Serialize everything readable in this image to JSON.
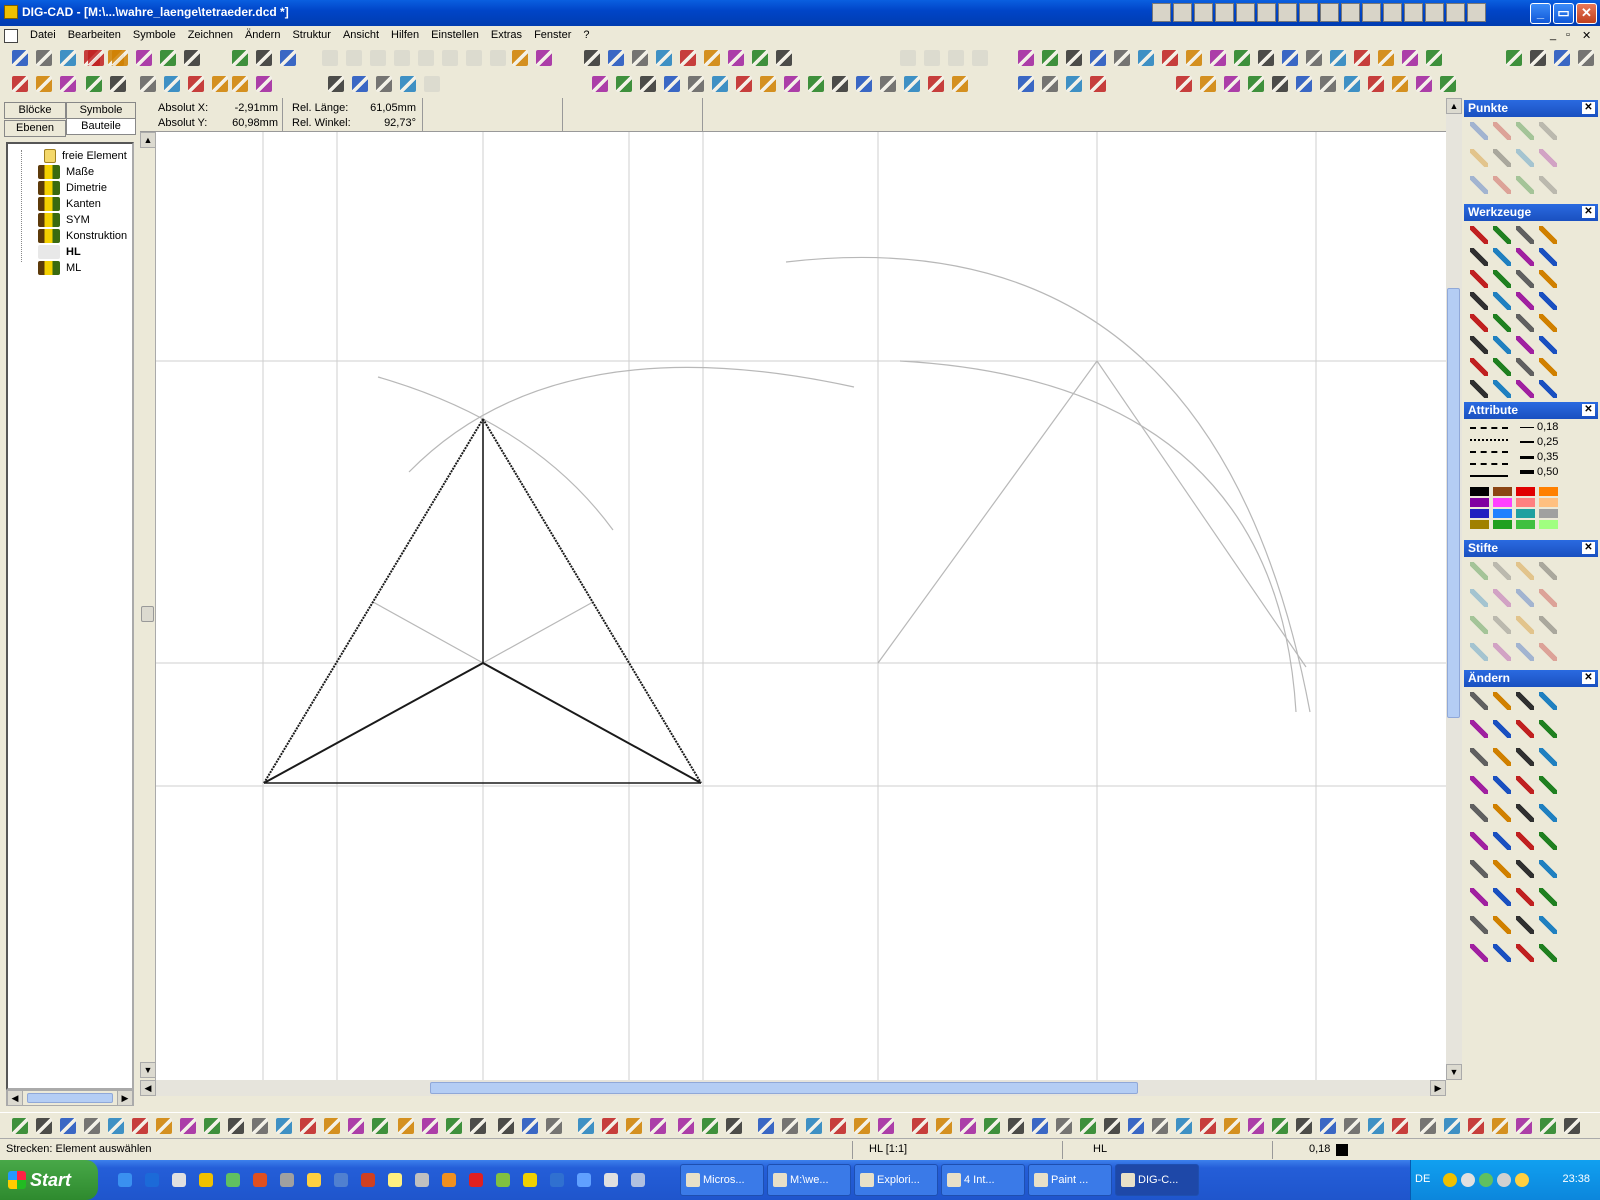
{
  "window": {
    "title": "DIG-CAD - [M:\\...\\wahre_laenge\\tetraeder.dcd *]",
    "min_glyph": "_",
    "max_glyph": "▭",
    "close_glyph": "✕"
  },
  "menu": {
    "items": [
      "Datei",
      "Bearbeiten",
      "Symbole",
      "Zeichnen",
      "Ändern",
      "Struktur",
      "Ansicht",
      "Hilfen",
      "Einstellen",
      "Extras",
      "Fenster",
      "?"
    ],
    "mdi_min": "_",
    "mdi_max": "▫",
    "mdi_close": "✕"
  },
  "left_panel": {
    "tabs": [
      "Blöcke",
      "Symbole",
      "Ebenen",
      "Bauteile"
    ],
    "tree": [
      {
        "label": "freie Element",
        "icon": "folder-icon",
        "bold": false
      },
      {
        "label": "Maße",
        "icon": "layer-group-icon",
        "bold": false
      },
      {
        "label": "Dimetrie",
        "icon": "layer-group-icon",
        "bold": false
      },
      {
        "label": "Kanten",
        "icon": "layer-group-icon",
        "bold": false
      },
      {
        "label": "SYM",
        "icon": "layer-group-icon",
        "bold": false
      },
      {
        "label": "Konstruktion",
        "icon": "layer-group-icon",
        "bold": false
      },
      {
        "label": "HL",
        "icon": "layer-group-inactive-icon",
        "bold": true
      },
      {
        "label": "ML",
        "icon": "layer-group-icon",
        "bold": false
      }
    ]
  },
  "coords": {
    "abs_x_label": "Absolut X:",
    "abs_x_value": "-2,91mm",
    "abs_y_label": "Absolut Y:",
    "abs_y_value": "60,98mm",
    "rel_len_label": "Rel. Länge:",
    "rel_len_value": "61,05mm",
    "rel_ang_label": "Rel. Winkel:",
    "rel_ang_value": "92,73°"
  },
  "right_panel": {
    "punkte": "Punkte",
    "werkzeuge": "Werkzeuge",
    "attribute": "Attribute",
    "stifte": "Stifte",
    "aendern": "Ändern",
    "line_widths": [
      "0,18",
      "0,25",
      "0,35",
      "0,50"
    ],
    "colors": [
      "#000000",
      "#8b4513",
      "#e00000",
      "#ff8000",
      "#8000a0",
      "#ff40ff",
      "#ff8080",
      "#ffc080",
      "#2020c0",
      "#2080ff",
      "#20a0a0",
      "#a0a0a0",
      "#a08000",
      "#20a020",
      "#40c040",
      "#a0ff80"
    ]
  },
  "status": {
    "message": "Strecken: Element auswählen",
    "view": "HL [1:1]",
    "layer": "HL",
    "pen_width": "0,18"
  },
  "taskbar": {
    "start": "Start",
    "tasks": [
      {
        "label": "Micros...",
        "active": false
      },
      {
        "label": "M:\\we...",
        "active": false
      },
      {
        "label": "Explori...",
        "active": false
      },
      {
        "label": "4 Int...",
        "active": false
      },
      {
        "label": "Paint ...",
        "active": false
      },
      {
        "label": "DIG-C...",
        "active": true
      }
    ],
    "lang": "DE",
    "clock": "23:38"
  }
}
